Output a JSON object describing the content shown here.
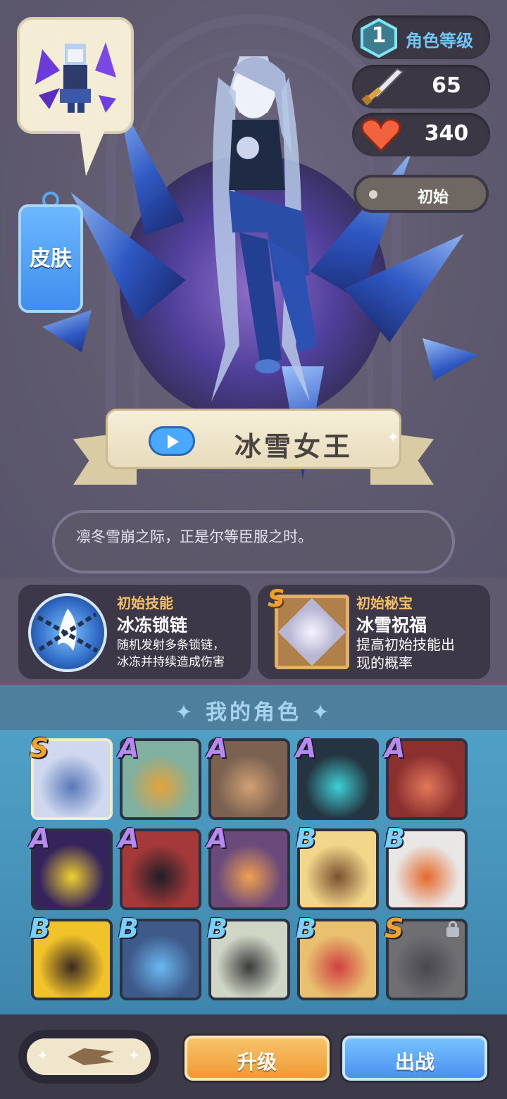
{
  "hero": {
    "name": "冰雪女王",
    "quote": "凛冬雪崩之际，正是尔等臣服之时。",
    "skin_label": "皮肤",
    "level": {
      "value": "1",
      "label": "角色等级"
    },
    "attack": "65",
    "hp": "340",
    "skin_state": "初始"
  },
  "skill": {
    "tag": "初始技能",
    "name": "冰冻锁链",
    "desc_line1": "随机发射多条锁链，",
    "desc_line2": "冰冻并持续造成伤害"
  },
  "treasure": {
    "rank": "S",
    "tag": "初始秘宝",
    "name": "冰雪祝福",
    "desc_line1": "提高初始技能出",
    "desc_line2": "现的概率"
  },
  "roles": {
    "title": "我的角色",
    "items": [
      {
        "rank": "S",
        "color": "#cfd8ef",
        "accent": "#5a78b8",
        "locked": false
      },
      {
        "rank": "A",
        "color": "#7fb0a0",
        "accent": "#e6a33a",
        "locked": false
      },
      {
        "rank": "A",
        "color": "#7a6150",
        "accent": "#d1a073",
        "locked": false
      },
      {
        "rank": "A",
        "color": "#243440",
        "accent": "#3fd0d8",
        "locked": false
      },
      {
        "rank": "A",
        "color": "#8c2f2f",
        "accent": "#e0785a",
        "locked": false
      },
      {
        "rank": "A",
        "color": "#35245c",
        "accent": "#f0d030",
        "locked": false
      },
      {
        "rank": "A",
        "color": "#a5393a",
        "accent": "#1e1e26",
        "locked": false
      },
      {
        "rank": "A",
        "color": "#6a4a7a",
        "accent": "#f0a050",
        "locked": false
      },
      {
        "rank": "B",
        "color": "#f2d68a",
        "accent": "#7a5030",
        "locked": false
      },
      {
        "rank": "B",
        "color": "#e9e6e6",
        "accent": "#e6682a",
        "locked": false
      },
      {
        "rank": "B",
        "color": "#f2c22a",
        "accent": "#3a2a22",
        "locked": false
      },
      {
        "rank": "B",
        "color": "#3e5a8a",
        "accent": "#6ab8f0",
        "locked": false
      },
      {
        "rank": "B",
        "color": "#cfd6c6",
        "accent": "#3a3a3a",
        "locked": false
      },
      {
        "rank": "B",
        "color": "#e8c070",
        "accent": "#d04040",
        "locked": false
      },
      {
        "rank": "S",
        "color": "#8a8a98",
        "accent": "#5a5a6a",
        "locked": true
      }
    ]
  },
  "bottom": {
    "upgrade": "升级",
    "deploy": "出战"
  },
  "colors": {
    "upgrade": "#ef9a33",
    "deploy": "#4a8ff0",
    "accent_gold": "#f6c06a"
  }
}
